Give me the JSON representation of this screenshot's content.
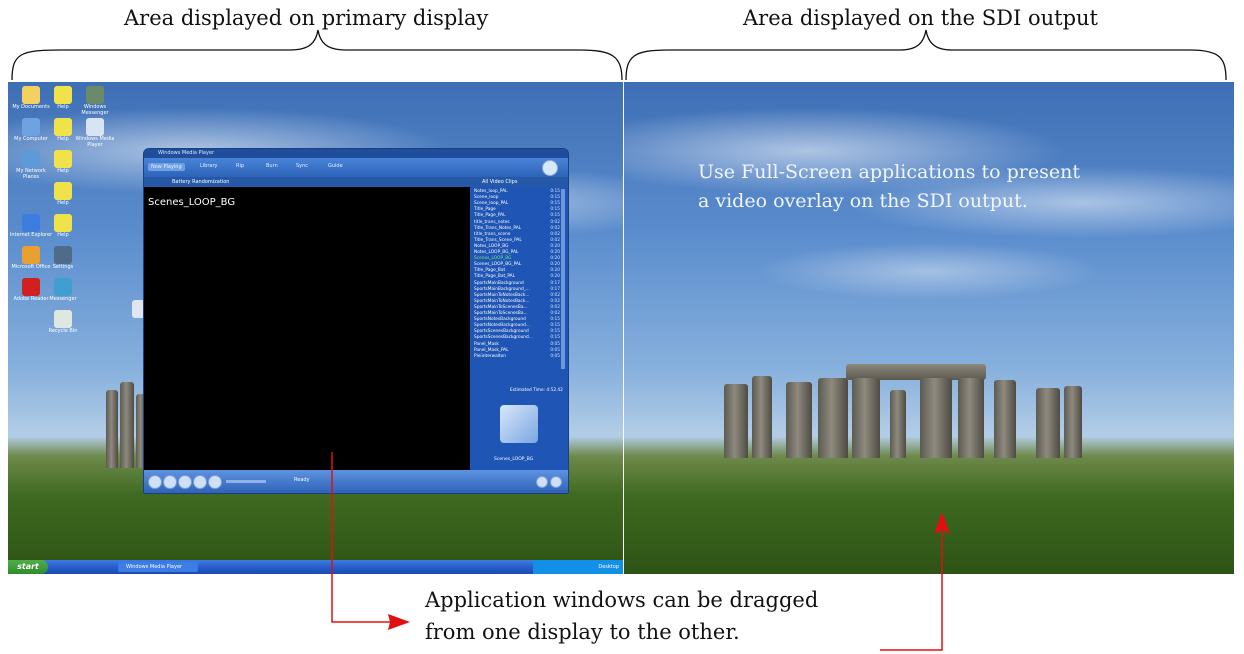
{
  "captions": {
    "primary": "Area displayed on primary display",
    "sdi": "Area displayed on the SDI output"
  },
  "sdi_overlay": {
    "line1": "Use Full-Screen applications to present",
    "line2": "a video overlay on the SDI output."
  },
  "annotation": {
    "line1": "Application windows can be dragged",
    "line2": "from one display to the other."
  },
  "colors": {
    "arrow": "#e01010",
    "taskbar": "#2459c8",
    "video_bg": "#000000",
    "playlist_current": "#7de37a"
  },
  "desktop": {
    "icons": [
      {
        "name": "My Documents",
        "icon": "folder-icon",
        "color": "#f4d060"
      },
      {
        "name": "Help",
        "icon": "help-icon",
        "color": "#f0e24a"
      },
      {
        "name": "Windows Messenger",
        "icon": "messenger-icon",
        "color": "#6a8a6a"
      },
      {
        "name": "My Computer",
        "icon": "computer-icon",
        "color": "#6fa2e0"
      },
      {
        "name": "Help",
        "icon": "help-icon",
        "color": "#f0e24a"
      },
      {
        "name": "Windows Media Player",
        "icon": "media-player-icon",
        "color": "#d8e4f4"
      },
      {
        "name": "My Network Places",
        "icon": "network-icon",
        "color": "#5d9ad8"
      },
      {
        "name": "Help",
        "icon": "help-icon",
        "color": "#f0e24a"
      },
      {
        "name": "Help",
        "icon": "help-icon",
        "color": "#f0e24a"
      },
      {
        "name": "Internet Explorer",
        "icon": "ie-icon",
        "color": "#3d7de0"
      },
      {
        "name": "Help",
        "icon": "help-icon",
        "color": "#f0e24a"
      },
      {
        "name": "Microsoft Office",
        "icon": "office-icon",
        "color": "#e8a030"
      },
      {
        "name": "Settings",
        "icon": "settings-icon",
        "color": "#506a8a"
      },
      {
        "name": "Adobe Reader",
        "icon": "adobe-icon",
        "color": "#d02020"
      },
      {
        "name": "Messenger",
        "icon": "chat-icon",
        "color": "#3fa0d0"
      },
      {
        "name": "Recycle Bin",
        "icon": "recycle-bin-icon",
        "color": "#dfe8e0"
      }
    ]
  },
  "taskbar": {
    "start": "start",
    "task": "Windows Media Player",
    "tray": "Desktop"
  },
  "wmp": {
    "title": "Windows Media Player",
    "tabs": [
      "Now Playing",
      "Library",
      "Rip",
      "Burn",
      "Sync",
      "Guide"
    ],
    "bar_text": "Battery  Randomization",
    "list_header": "All Video Clips",
    "video_title": "Scenes_LOOP_BG",
    "now_playing_label": "Scenes_LOOP_BG",
    "status": "Ready",
    "total_time": "Estimated Time: 4:52.42",
    "playlist": [
      {
        "name": "Notes_loop_PAL",
        "dur": "0:15"
      },
      {
        "name": "Scene_loop",
        "dur": "0:15"
      },
      {
        "name": "Scene_loop_PAL",
        "dur": "0:15"
      },
      {
        "name": "Title_Page",
        "dur": "0:15"
      },
      {
        "name": "Title_Page_PAL",
        "dur": "0:15"
      },
      {
        "name": "title_trans_notes",
        "dur": "0:02"
      },
      {
        "name": "Title_Trans_Notes_PAL",
        "dur": "0:02"
      },
      {
        "name": "title_trans_scene",
        "dur": "0:02"
      },
      {
        "name": "Title_Trans_Scene_PAL",
        "dur": "0:02"
      },
      {
        "name": "Notes_LOOP_BG",
        "dur": "0:20"
      },
      {
        "name": "Notes_LOOP_BG_PAL",
        "dur": "0:20"
      },
      {
        "name": "Scenes_LOOP_BG",
        "dur": "0:20",
        "current": true
      },
      {
        "name": "Scenes_LOOP_BG_PAL",
        "dur": "0:20"
      },
      {
        "name": "Title_Page_Bat",
        "dur": "0:20"
      },
      {
        "name": "Title_Page_Bat_PAL",
        "dur": "0:20"
      },
      {
        "name": "SportsMainBackground",
        "dur": "0:17"
      },
      {
        "name": "SportsMainBackground_...",
        "dur": "0:17"
      },
      {
        "name": "SportsMainToNotesBack...",
        "dur": "0:02"
      },
      {
        "name": "SportsMainToNotesBack...",
        "dur": "0:02"
      },
      {
        "name": "SportsMainToScenesBa...",
        "dur": "0:02"
      },
      {
        "name": "SportsMainToScenesBa...",
        "dur": "0:02"
      },
      {
        "name": "SportsNotesBackground",
        "dur": "0:15"
      },
      {
        "name": "SportsNotesBackground...",
        "dur": "0:15"
      },
      {
        "name": "SportsScenesBackground",
        "dur": "0:15"
      },
      {
        "name": "SportsScenesBackground...",
        "dur": "0:15"
      },
      {
        "name": "Panel_Mask",
        "dur": "0:05"
      },
      {
        "name": "Panel_Mask_PAL",
        "dur": "0:05"
      },
      {
        "name": "Pleiinterwalton",
        "dur": "0:05"
      }
    ]
  }
}
